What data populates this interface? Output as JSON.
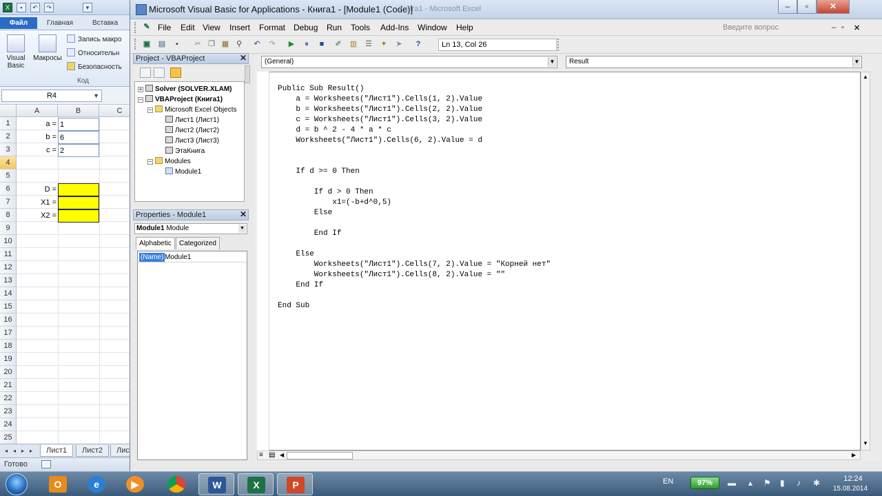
{
  "excel": {
    "tabs": {
      "file": "Файл",
      "home": "Главная",
      "insert": "Вставка"
    },
    "ribbon": {
      "visual_basic": "Visual Basic",
      "macros": "Макросы",
      "record_macro": "Запись макро",
      "relative_refs": "Относительн",
      "security": "Безопасность",
      "group_label": "Код"
    },
    "name_box": "R4",
    "columns": [
      "A",
      "B",
      "C"
    ],
    "rows": [
      "1",
      "2",
      "3",
      "4",
      "5",
      "6",
      "7",
      "8",
      "9",
      "10",
      "11",
      "12",
      "13",
      "14",
      "15",
      "16",
      "17",
      "18",
      "19",
      "20",
      "21",
      "22",
      "23",
      "24",
      "25"
    ],
    "cells": {
      "a_label": "a =",
      "a_value": "1",
      "b_label": "b =",
      "b_value": "6",
      "c_label": "c =",
      "c_value": "2",
      "d_label": "D =",
      "x1_label": "X1 =",
      "x2_label": "X2 ="
    },
    "sheets": [
      "Лист1",
      "Лист2",
      "Лис"
    ],
    "status": "Готово"
  },
  "vbe": {
    "title": "Microsoft Visual Basic for Applications - Книга1 - [Module1 (Code)]",
    "title_ghost": "Книга1 - Microsoft Excel",
    "menu": [
      "File",
      "Edit",
      "View",
      "Insert",
      "Format",
      "Debug",
      "Run",
      "Tools",
      "Add-Ins",
      "Window",
      "Help"
    ],
    "help_placeholder": "Введите вопрос",
    "status_pos": "Ln 13, Col 26",
    "project": {
      "title": "Project - VBAProject",
      "nodes": {
        "solver": "Solver (SOLVER.XLAM)",
        "vbaproject": "VBAProject (Книга1)",
        "excel_objects": "Microsoft Excel Objects",
        "sheet1": "Лист1 (Лист1)",
        "sheet2": "Лист2 (Лист2)",
        "sheet3": "Лист3 (Лист3)",
        "workbook": "ЭтаКнига",
        "modules": "Modules",
        "module1": "Module1"
      }
    },
    "properties": {
      "title": "Properties - Module1",
      "object_bold": "Module1",
      "object_type": "Module",
      "tab_alpha": "Alphabetic",
      "tab_cat": "Categorized",
      "prop_name": "(Name)",
      "prop_value": "Module1"
    },
    "code": {
      "object_combo": "(General)",
      "proc_combo": "Result",
      "lines": [
        "Public Sub Result()",
        "    a = Worksheets(\"Лист1\").Cells(1, 2).Value",
        "    b = Worksheets(\"Лист1\").Cells(2, 2).Value",
        "    c = Worksheets(\"Лист1\").Cells(3, 2).Value",
        "    d = b ^ 2 - 4 * a * c",
        "    Worksheets(\"Лист1\").Cells(6, 2).Value = d",
        "",
        "",
        "    If d >= 0 Then",
        "",
        "        If d > 0 Then",
        "            x1=(-b+d^0,5)",
        "        Else",
        "",
        "        End If",
        "",
        "    Else",
        "        Worksheets(\"Лист1\").Cells(7, 2).Value = \"Корней нет\"",
        "        Worksheets(\"Лист1\").Cells(8, 2).Value = \"\"",
        "    End If",
        "",
        "End Sub"
      ]
    }
  },
  "taskbar": {
    "lang": "EN",
    "battery": "97%",
    "time": "12:24",
    "date": "15.08.2014",
    "apps": [
      "outlook-icon",
      "ie-icon",
      "media-player-icon",
      "chrome-icon",
      "word-icon",
      "excel-icon",
      "powerpoint-icon"
    ]
  }
}
